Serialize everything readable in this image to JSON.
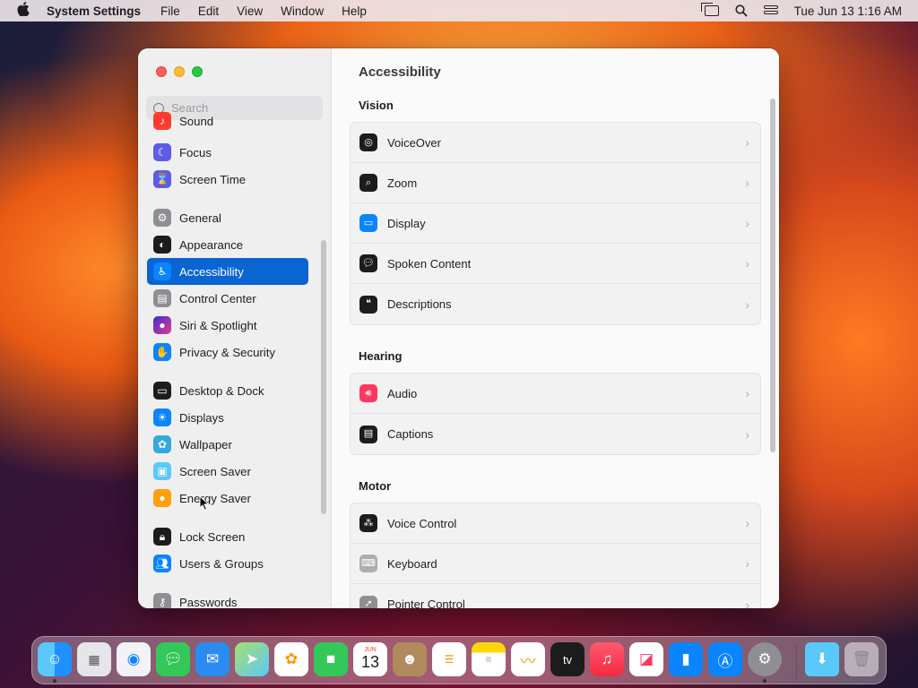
{
  "menubar": {
    "app_name": "System Settings",
    "menus": [
      "File",
      "Edit",
      "View",
      "Window",
      "Help"
    ],
    "clock": "Tue Jun 13  1:16 AM"
  },
  "window": {
    "search_placeholder": "Search",
    "sidebar": {
      "items": [
        {
          "label": "Sound",
          "icon": "sound-icon",
          "color": "#ff3b30",
          "active": false
        },
        {
          "label": "Focus",
          "icon": "moon-icon",
          "color": "#5e5ce6",
          "active": false
        },
        {
          "label": "Screen Time",
          "icon": "hourglass-icon",
          "color": "#5e5ce6",
          "active": false
        },
        {
          "label": "General",
          "icon": "gear-icon",
          "color": "#8e8e93",
          "active": false
        },
        {
          "label": "Appearance",
          "icon": "appearance-icon",
          "color": "#1c1c1e",
          "active": false
        },
        {
          "label": "Accessibility",
          "icon": "accessibility-icon",
          "color": "#0a84ff",
          "active": true
        },
        {
          "label": "Control Center",
          "icon": "control-center-icon",
          "color": "#8e8e93",
          "active": false
        },
        {
          "label": "Siri & Spotlight",
          "icon": "siri-icon",
          "color": "#d63a8a",
          "active": false
        },
        {
          "label": "Privacy & Security",
          "icon": "hand-icon",
          "color": "#0a84ff",
          "active": false
        },
        {
          "label": "Desktop & Dock",
          "icon": "dock-icon",
          "color": "#1c1c1e",
          "active": false
        },
        {
          "label": "Displays",
          "icon": "sun-icon",
          "color": "#0a84ff",
          "active": false
        },
        {
          "label": "Wallpaper",
          "icon": "flower-icon",
          "color": "#34aadc",
          "active": false
        },
        {
          "label": "Screen Saver",
          "icon": "screen-saver-icon",
          "color": "#5ac8fa",
          "active": false
        },
        {
          "label": "Energy Saver",
          "icon": "bulb-icon",
          "color": "#ff9f0a",
          "active": false
        },
        {
          "label": "Lock Screen",
          "icon": "lock-icon",
          "color": "#1c1c1e",
          "active": false
        },
        {
          "label": "Users & Groups",
          "icon": "users-icon",
          "color": "#0a84ff",
          "active": false
        },
        {
          "label": "Passwords",
          "icon": "key-icon",
          "color": "#8e8e93",
          "active": false
        }
      ]
    },
    "content": {
      "title": "Accessibility",
      "sections": [
        {
          "title": "Vision",
          "rows": [
            {
              "label": "VoiceOver",
              "icon": "voiceover-icon",
              "color": "#1c1c1e"
            },
            {
              "label": "Zoom",
              "icon": "zoom-icon",
              "color": "#1c1c1e"
            },
            {
              "label": "Display",
              "icon": "display-icon",
              "color": "#0a84ff"
            },
            {
              "label": "Spoken Content",
              "icon": "spoken-content-icon",
              "color": "#1c1c1e"
            },
            {
              "label": "Descriptions",
              "icon": "descriptions-icon",
              "color": "#1c1c1e"
            }
          ]
        },
        {
          "title": "Hearing",
          "rows": [
            {
              "label": "Audio",
              "icon": "speaker-icon",
              "color": "#ff375f"
            },
            {
              "label": "Captions",
              "icon": "captions-icon",
              "color": "#1c1c1e"
            }
          ]
        },
        {
          "title": "Motor",
          "rows": [
            {
              "label": "Voice Control",
              "icon": "voice-control-icon",
              "color": "#1c1c1e"
            },
            {
              "label": "Keyboard",
              "icon": "keyboard-icon",
              "color": "#aeaeb2"
            },
            {
              "label": "Pointer Control",
              "icon": "pointer-icon",
              "color": "#8e8e93"
            }
          ]
        }
      ]
    }
  },
  "dock": {
    "calendar_month": "JUN",
    "calendar_day": "13",
    "tv_label": "tv",
    "apps": [
      "Finder",
      "Launchpad",
      "Safari",
      "Messages",
      "Mail",
      "Maps",
      "Photos",
      "FaceTime",
      "Calendar",
      "Contacts",
      "Reminders",
      "Notes",
      "Freeform",
      "TV",
      "Music",
      "News",
      "Keynote",
      "App Store",
      "System Settings",
      "Downloads",
      "Trash"
    ]
  }
}
